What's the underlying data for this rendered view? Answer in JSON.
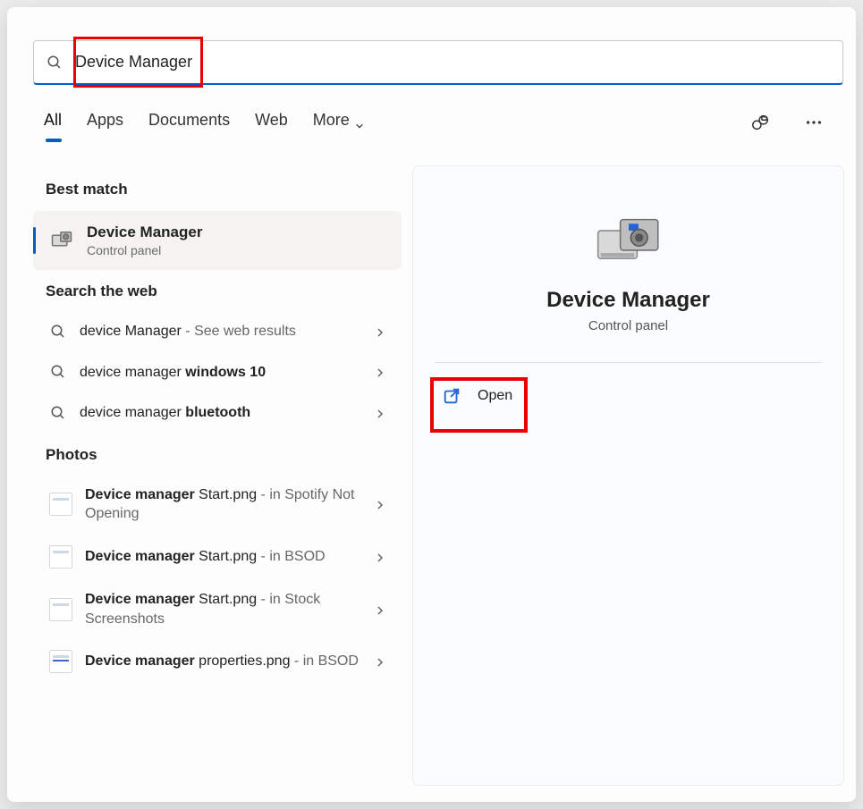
{
  "search": {
    "query": "Device Manager"
  },
  "tabs": {
    "all": "All",
    "apps": "Apps",
    "docs": "Documents",
    "web": "Web",
    "more": "More"
  },
  "sections": {
    "best": "Best match",
    "web": "Search the web",
    "photos": "Photos"
  },
  "best": {
    "title": "Device Manager",
    "subtitle": "Control panel"
  },
  "web_results": [
    {
      "prefix": "device Manager",
      "suffix": " - See web results"
    },
    {
      "prefix": "device manager ",
      "bold": "windows 10"
    },
    {
      "prefix": "device manager ",
      "bold": "bluetooth"
    }
  ],
  "photos": [
    {
      "bold": "Device manager",
      "rest": " Start.png",
      "loc": " - in Spotify Not Opening"
    },
    {
      "bold": "Device manager",
      "rest": " Start.png",
      "loc": " - in BSOD"
    },
    {
      "bold": "Device manager",
      "rest": " Start.png",
      "loc": " - in Stock Screenshots"
    },
    {
      "bold": "Device manager",
      "rest": " properties.png",
      "loc": " - in BSOD"
    }
  ],
  "preview": {
    "title": "Device Manager",
    "subtitle": "Control panel",
    "open": "Open"
  }
}
